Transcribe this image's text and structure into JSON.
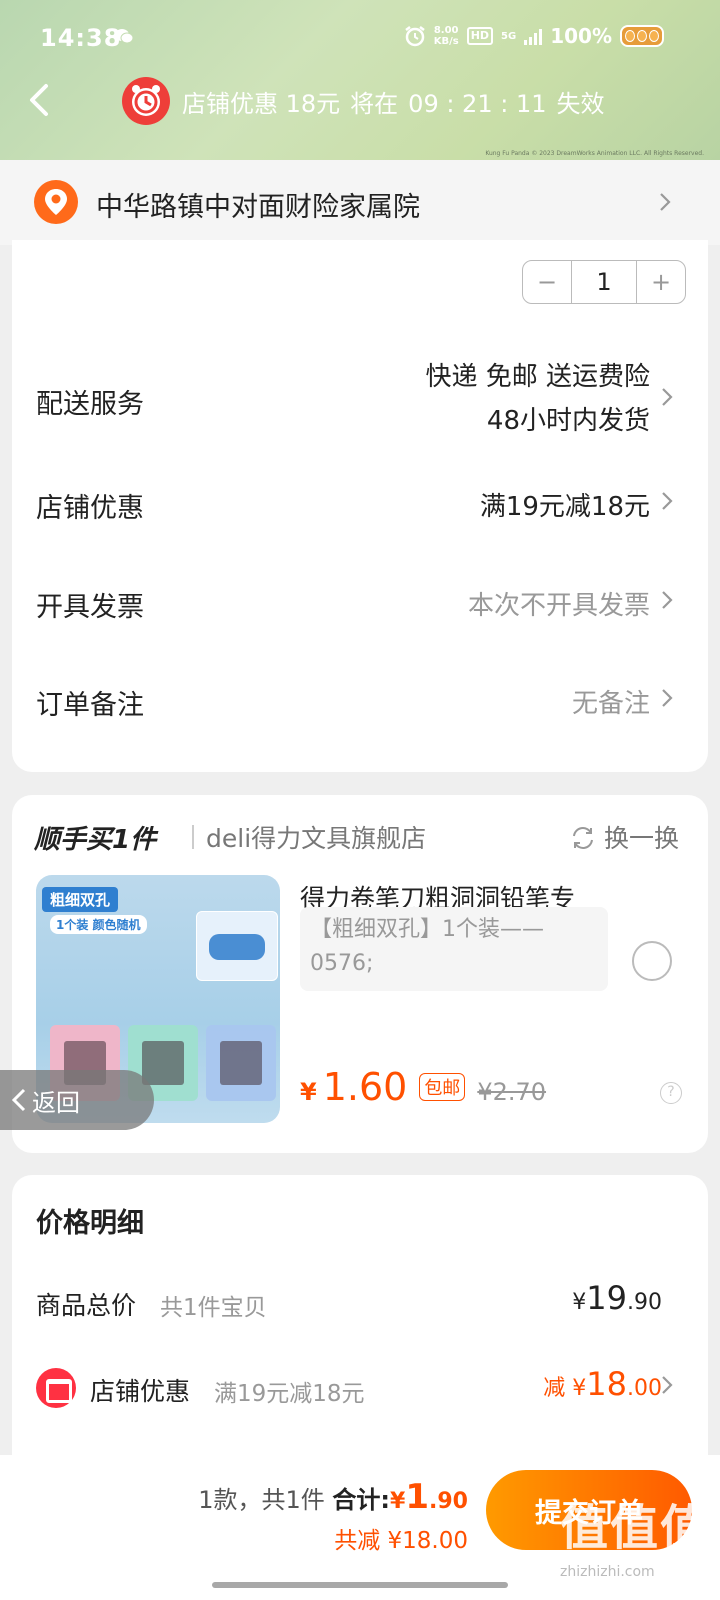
{
  "status_bar": {
    "time": "14:38",
    "net_speed_value": "8.00",
    "net_speed_unit": "KB/s",
    "hd": "HD",
    "network": "5G",
    "battery": "100%"
  },
  "header": {
    "promo_label": "店铺优惠 18元",
    "promo_expire_prefix": "将在",
    "countdown": "09 : 21 : 11",
    "promo_expire_suffix": "失效",
    "copyright": "Kung Fu Panda © 2023 DreamWorks Animation LLC. All Rights Reserved."
  },
  "address": {
    "text": "中华路镇中对面财险家属院"
  },
  "order": {
    "quantity": "1",
    "rows": [
      {
        "label": "配送服务",
        "value_line1": "快递 免邮 送运费险",
        "value_line2": "48小时内发货"
      },
      {
        "label": "店铺优惠",
        "value": "满19元减18元"
      },
      {
        "label": "开具发票",
        "value": "本次不开具发票"
      },
      {
        "label": "订单备注",
        "value": "无备注"
      }
    ]
  },
  "addon": {
    "title": "顺手买1件",
    "shop": "deli得力文具旗舰店",
    "swap": "换一换",
    "image_tag1": "粗细双孔",
    "image_tag2": "1个装  颜色随机",
    "product_title": "得力卷笔刀粗洞洞铅笔专",
    "sku_line1": "【粗细双孔】1个装——",
    "sku_line2": "0576;",
    "price_symbol": "¥",
    "price": "1.60",
    "free_shipping": "包邮",
    "original_price": "¥2.70"
  },
  "float_back": {
    "label": "返回"
  },
  "price_detail": {
    "title": "价格明细",
    "goods_total_label": "商品总价",
    "goods_total_sub": "共1件宝贝",
    "goods_total_symbol": "¥",
    "goods_total_int": "19",
    "goods_total_dec": ".90",
    "shop_discount_label": "店铺优惠",
    "shop_discount_sub": "满19元减18元",
    "shop_discount_prefix": "减 ¥",
    "shop_discount_int": "18",
    "shop_discount_dec": ".00"
  },
  "bottom_bar": {
    "count_text": "1款，共1件",
    "total_label": "合计:",
    "total_symbol": "¥",
    "total_int": "1",
    "total_dec": ".90",
    "saved_text": "共减 ¥18.00",
    "submit": "提交订单"
  },
  "watermark": {
    "text": "值值值",
    "url": "zhizhizhi.com"
  },
  "colors": {
    "accent": "#ff5000",
    "submit_start": "#ff9a00",
    "submit_end": "#ff5a00"
  }
}
